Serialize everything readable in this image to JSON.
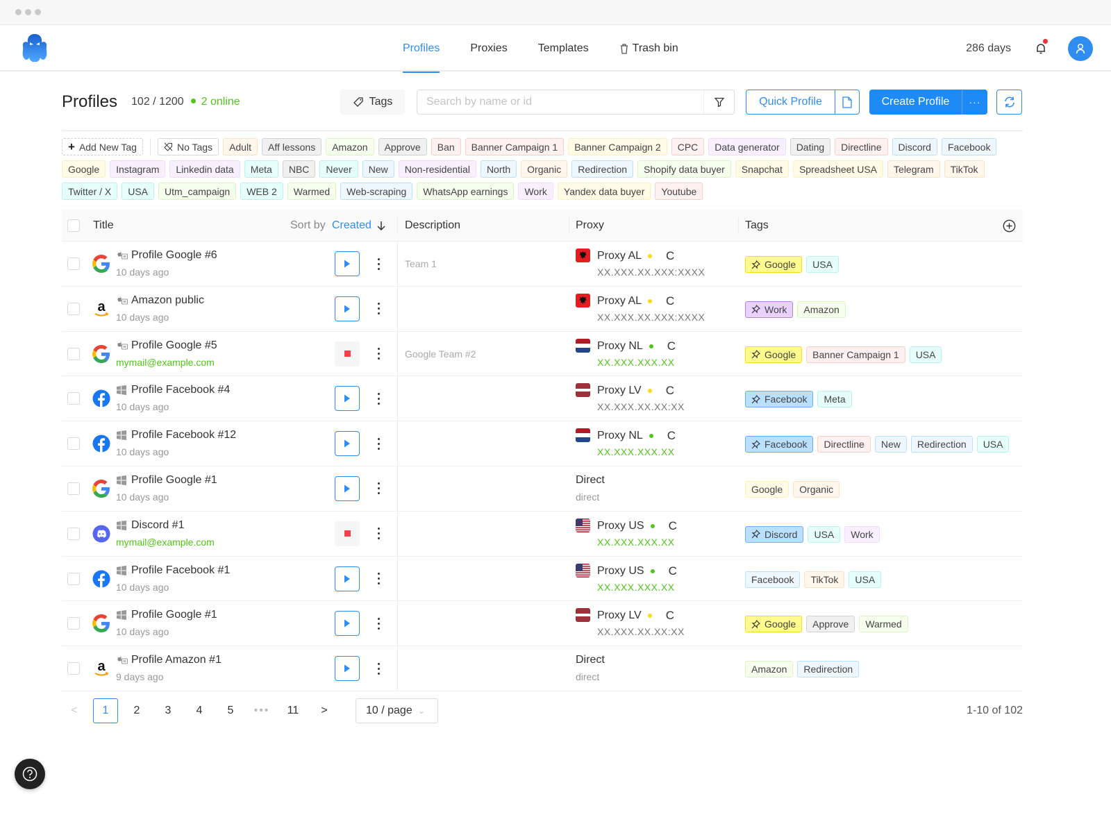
{
  "window": {
    "controls": [
      "close",
      "minimize",
      "maximize"
    ]
  },
  "nav": {
    "tabs": [
      {
        "label": "Profiles",
        "active": true
      },
      {
        "label": "Proxies",
        "active": false
      },
      {
        "label": "Templates",
        "active": false
      },
      {
        "label": "Trash bin",
        "active": false,
        "icon": "trash-icon"
      }
    ],
    "subscription_days": "286 days",
    "notifications_unread": true
  },
  "header": {
    "title": "Profiles",
    "count": "102 / 1200",
    "online": "2 online",
    "tags_button": "Tags",
    "search_placeholder": "Search by name or id",
    "search_value": "",
    "quick_profile": "Quick Profile",
    "create_profile": "Create Profile",
    "more_label": "···"
  },
  "tag_filters": {
    "add_new": "Add New Tag",
    "no_tags": "No Tags",
    "tags": [
      {
        "label": "Adult",
        "color": "orange"
      },
      {
        "label": "Aff lessons",
        "color": "gray"
      },
      {
        "label": "Amazon",
        "color": "green"
      },
      {
        "label": "Approve",
        "color": "gray"
      },
      {
        "label": "Ban",
        "color": "red"
      },
      {
        "label": "Banner Campaign 1",
        "color": "red"
      },
      {
        "label": "Banner Campaign 2",
        "color": "yellow"
      },
      {
        "label": "CPC",
        "color": "red"
      },
      {
        "label": "Data generator",
        "color": "purple"
      },
      {
        "label": "Dating",
        "color": "gray"
      },
      {
        "label": "Directline",
        "color": "red"
      },
      {
        "label": "Discord",
        "color": "blue"
      },
      {
        "label": "Facebook",
        "color": "blue"
      },
      {
        "label": "Google",
        "color": "yellow"
      },
      {
        "label": "Instagram",
        "color": "purple"
      },
      {
        "label": "Linkedin data",
        "color": "purple"
      },
      {
        "label": "Meta",
        "color": "cyan"
      },
      {
        "label": "NBC",
        "color": "gray"
      },
      {
        "label": "Never",
        "color": "cyan"
      },
      {
        "label": "New",
        "color": "blue"
      },
      {
        "label": "Non-residential",
        "color": "purple"
      },
      {
        "label": "North",
        "color": "blue"
      },
      {
        "label": "Organic",
        "color": "orange"
      },
      {
        "label": "Redirection",
        "color": "blue"
      },
      {
        "label": "Shopify data buyer",
        "color": "green"
      },
      {
        "label": "Snapchat",
        "color": "yellow"
      },
      {
        "label": "Spreadsheet USA",
        "color": "yellow"
      },
      {
        "label": "Telegram",
        "color": "orange"
      },
      {
        "label": "TikTok",
        "color": "orange"
      },
      {
        "label": "Twitter / X",
        "color": "cyan"
      },
      {
        "label": "USA",
        "color": "cyan"
      },
      {
        "label": "Utm_campaign",
        "color": "green"
      },
      {
        "label": "WEB 2",
        "color": "cyan"
      },
      {
        "label": "Warmed",
        "color": "green"
      },
      {
        "label": "Web-scraping",
        "color": "blue"
      },
      {
        "label": "WhatsApp earnings",
        "color": "green"
      },
      {
        "label": "Work",
        "color": "purple"
      },
      {
        "label": "Yandex data buyer",
        "color": "yellow"
      },
      {
        "label": "Youtube",
        "color": "red"
      }
    ]
  },
  "table": {
    "columns": {
      "title": "Title",
      "sort_prefix": "Sort by",
      "sort_field": "Created",
      "description": "Description",
      "proxy": "Proxy",
      "tags": "Tags"
    },
    "rows": [
      {
        "brand": "google",
        "os": "macos",
        "title": "Profile Google #6",
        "sub": "10 days ago",
        "sub_is_email": false,
        "running": false,
        "description": "Team 1",
        "proxy": {
          "type": "proxy",
          "flag": "AL",
          "name": "Proxy AL",
          "status": "yellow",
          "address": "XX.XXX.XX.XXX:XXXX",
          "address_ok": false
        },
        "tags": [
          {
            "label": "Google",
            "color": "pin-yellow",
            "pinned": true
          },
          {
            "label": "USA",
            "color": "cyan"
          }
        ]
      },
      {
        "brand": "amazon",
        "os": "macos",
        "title": "Amazon public",
        "sub": "10 days ago",
        "sub_is_email": false,
        "running": false,
        "description": "",
        "proxy": {
          "type": "proxy",
          "flag": "AL",
          "name": "Proxy AL",
          "status": "yellow",
          "address": "XX.XXX.XX.XXX:XXXX",
          "address_ok": false
        },
        "tags": [
          {
            "label": "Work",
            "color": "pin-purple",
            "pinned": true
          },
          {
            "label": "Amazon",
            "color": "green"
          }
        ]
      },
      {
        "brand": "google",
        "os": "macos",
        "title": "Profile Google #5",
        "sub": "mymail@example.com",
        "sub_is_email": true,
        "running": true,
        "description": "Google Team #2",
        "proxy": {
          "type": "proxy",
          "flag": "NL",
          "name": "Proxy NL",
          "status": "green",
          "address": "XX.XXX.XXX.XX",
          "address_ok": true
        },
        "tags": [
          {
            "label": "Google",
            "color": "pin-yellow",
            "pinned": true
          },
          {
            "label": "Banner Campaign 1",
            "color": "red"
          },
          {
            "label": "USA",
            "color": "cyan"
          }
        ]
      },
      {
        "brand": "facebook",
        "os": "windows",
        "title": "Profile Facebook #4",
        "sub": "10 days ago",
        "sub_is_email": false,
        "running": false,
        "description": "",
        "proxy": {
          "type": "proxy",
          "flag": "LV",
          "name": "Proxy LV",
          "status": "yellow",
          "address": "XX.XXX.XX.XX:XX",
          "address_ok": false
        },
        "tags": [
          {
            "label": "Facebook",
            "color": "pin-blue",
            "pinned": true
          },
          {
            "label": "Meta",
            "color": "cyan"
          }
        ]
      },
      {
        "brand": "facebook",
        "os": "windows",
        "title": "Profile Facebook #12",
        "sub": "10 days ago",
        "sub_is_email": false,
        "running": false,
        "description": "",
        "proxy": {
          "type": "proxy",
          "flag": "NL",
          "name": "Proxy NL",
          "status": "green",
          "address": "XX.XXX.XXX.XX",
          "address_ok": true
        },
        "tags": [
          {
            "label": "Facebook",
            "color": "pin-blue",
            "pinned": true
          },
          {
            "label": "Directline",
            "color": "red"
          },
          {
            "label": "New",
            "color": "blue"
          },
          {
            "label": "Redirection",
            "color": "blue"
          },
          {
            "label": "USA",
            "color": "cyan"
          }
        ]
      },
      {
        "brand": "google",
        "os": "windows",
        "title": "Profile Google #1",
        "sub": "10 days ago",
        "sub_is_email": false,
        "running": false,
        "description": "",
        "proxy": {
          "type": "direct",
          "name": "Direct",
          "address": "direct"
        },
        "tags": [
          {
            "label": "Google",
            "color": "yellow"
          },
          {
            "label": "Organic",
            "color": "orange"
          }
        ]
      },
      {
        "brand": "discord",
        "os": "windows",
        "title": "Discord #1",
        "sub": "mymail@example.com",
        "sub_is_email": true,
        "running": true,
        "description": "",
        "proxy": {
          "type": "proxy",
          "flag": "US",
          "name": "Proxy US",
          "status": "green",
          "address": "XX.XXX.XXX.XX",
          "address_ok": true
        },
        "tags": [
          {
            "label": "Discord",
            "color": "pin-blue",
            "pinned": true
          },
          {
            "label": "USA",
            "color": "cyan"
          },
          {
            "label": "Work",
            "color": "purple"
          }
        ]
      },
      {
        "brand": "facebook",
        "os": "windows",
        "title": "Profile Facebook #1",
        "sub": "10 days ago",
        "sub_is_email": false,
        "running": false,
        "description": "",
        "proxy": {
          "type": "proxy",
          "flag": "US",
          "name": "Proxy US",
          "status": "green",
          "address": "XX.XXX.XXX.XX",
          "address_ok": true
        },
        "tags": [
          {
            "label": "Facebook",
            "color": "blue"
          },
          {
            "label": "TikTok",
            "color": "orange"
          },
          {
            "label": "USA",
            "color": "cyan"
          }
        ]
      },
      {
        "brand": "google",
        "os": "windows",
        "title": "Profile Google #1",
        "sub": "10 days ago",
        "sub_is_email": false,
        "running": false,
        "description": "",
        "proxy": {
          "type": "proxy",
          "flag": "LV",
          "name": "Proxy LV",
          "status": "yellow",
          "address": "XX.XXX.XX.XX:XX",
          "address_ok": false
        },
        "tags": [
          {
            "label": "Google",
            "color": "pin-yellow",
            "pinned": true
          },
          {
            "label": "Approve",
            "color": "gray"
          },
          {
            "label": "Warmed",
            "color": "green"
          }
        ]
      },
      {
        "brand": "amazon",
        "os": "macos",
        "title": "Profile Amazon #1",
        "sub": "9 days ago",
        "sub_is_email": false,
        "running": false,
        "description": "",
        "proxy": {
          "type": "direct",
          "name": "Direct",
          "address": "direct"
        },
        "tags": [
          {
            "label": "Amazon",
            "color": "green"
          },
          {
            "label": "Redirection",
            "color": "blue"
          }
        ]
      }
    ]
  },
  "pagination": {
    "prev": "<",
    "pages": [
      "1",
      "2",
      "3",
      "4",
      "5",
      "•••",
      "11"
    ],
    "current": "1",
    "next": ">",
    "page_size": "10 / page",
    "total": "1-10 of 102"
  },
  "colors": {
    "accent": "#2f8cf0",
    "online": "#52c41a",
    "stop": "#f5424b",
    "warning": "#fadb14"
  }
}
